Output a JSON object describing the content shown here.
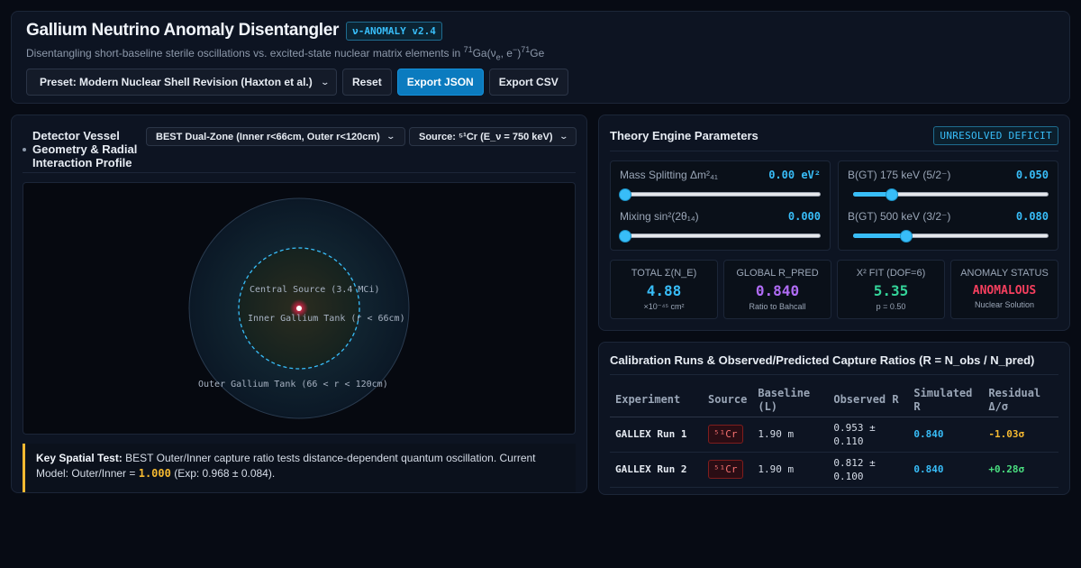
{
  "header": {
    "title": "Gallium Neutrino Anomaly Disentangler",
    "version": "ν-ANOMALY v2.4",
    "subtitle_pre": "Disentangling short-baseline sterile oscillations vs. excited-state nuclear matrix elements in ",
    "sub_mass1": "71",
    "sub_ga": "Ga(ν",
    "sub_e": "e",
    "sub_mid": ", e",
    "sub_minus": "−",
    "sub_close": ")",
    "sub_mass2": "71",
    "sub_ge": "Ge",
    "preset_value": "Preset: Modern Nuclear Shell Revision (Haxton et al.)",
    "reset_label": "Reset",
    "export_json_label": "Export JSON",
    "export_csv_label": "Export CSV"
  },
  "detector": {
    "title": "Detector Vessel Geometry & Radial Interaction Profile",
    "geometry_value": "BEST Dual-Zone (Inner r<66cm, Outer r<120cm)",
    "source_value": "Source: ⁵¹Cr (E_ν = 750 keV)",
    "labels": {
      "source": "Central Source (3.4 MCi)",
      "inner": "Inner Gallium Tank (r < 66cm)",
      "outer": "Outer Gallium Tank (66 < r < 120cm)"
    },
    "note_lead": "Key Spatial Test:",
    "note_text": " BEST Outer/Inner capture ratio tests distance-dependent quantum oscillation. Current Model: Outer/Inner = ",
    "note_value": "1.000",
    "note_exp": " (Exp: 0.968 ± 0.084)."
  },
  "theory": {
    "title": "Theory Engine Parameters",
    "badge": "UNRESOLVED DEFICIT",
    "params": [
      {
        "label": "Mass Splitting Δm²₄₁",
        "value": "0.00 eV²",
        "level": 0.0
      },
      {
        "label": "Mixing sin²(2θ₁₄)",
        "value": "0.000",
        "level": 0.0
      },
      {
        "label": "B(GT) 175 keV (5/2⁻)",
        "value": "0.050",
        "level": 0.2
      },
      {
        "label": "B(GT) 500 keV (3/2⁻)",
        "value": "0.080",
        "level": 0.27
      }
    ],
    "stats": [
      {
        "label": "TOTAL Σ(N_E)",
        "value": "4.88",
        "sub": "×10⁻⁴⁵ cm²",
        "color": "#38bdf8"
      },
      {
        "label": "GLOBAL R_PRED",
        "value": "0.840",
        "sub": "Ratio to Bahcall",
        "color": "#b06cf5"
      },
      {
        "label": "X² FIT (DOF=6)",
        "value": "5.35",
        "sub": "p = 0.50",
        "color": "#34d399"
      },
      {
        "label": "ANOMALY STATUS",
        "value": "ANOMALOUS",
        "sub": "Nuclear Solution",
        "color": "#f43f5e"
      }
    ]
  },
  "calibration": {
    "title": "Calibration Runs & Observed/Predicted Capture Ratios (R = N_obs / N_pred)",
    "columns": [
      "Experiment",
      "Source",
      "Baseline (L)",
      "Observed R",
      "Simulated R",
      "Residual Δ/σ"
    ],
    "rows": [
      {
        "experiment": "GALLEX Run 1",
        "source": "⁵¹Cr",
        "baseline": "1.90 m",
        "observed": "0.953 ± 0.110",
        "simulated": "0.840",
        "residual": "-1.03σ"
      },
      {
        "experiment": "GALLEX Run 2",
        "source": "⁵¹Cr",
        "baseline": "1.90 m",
        "observed": "0.812 ± 0.100",
        "simulated": "0.840",
        "residual": "+0.28σ"
      }
    ]
  }
}
